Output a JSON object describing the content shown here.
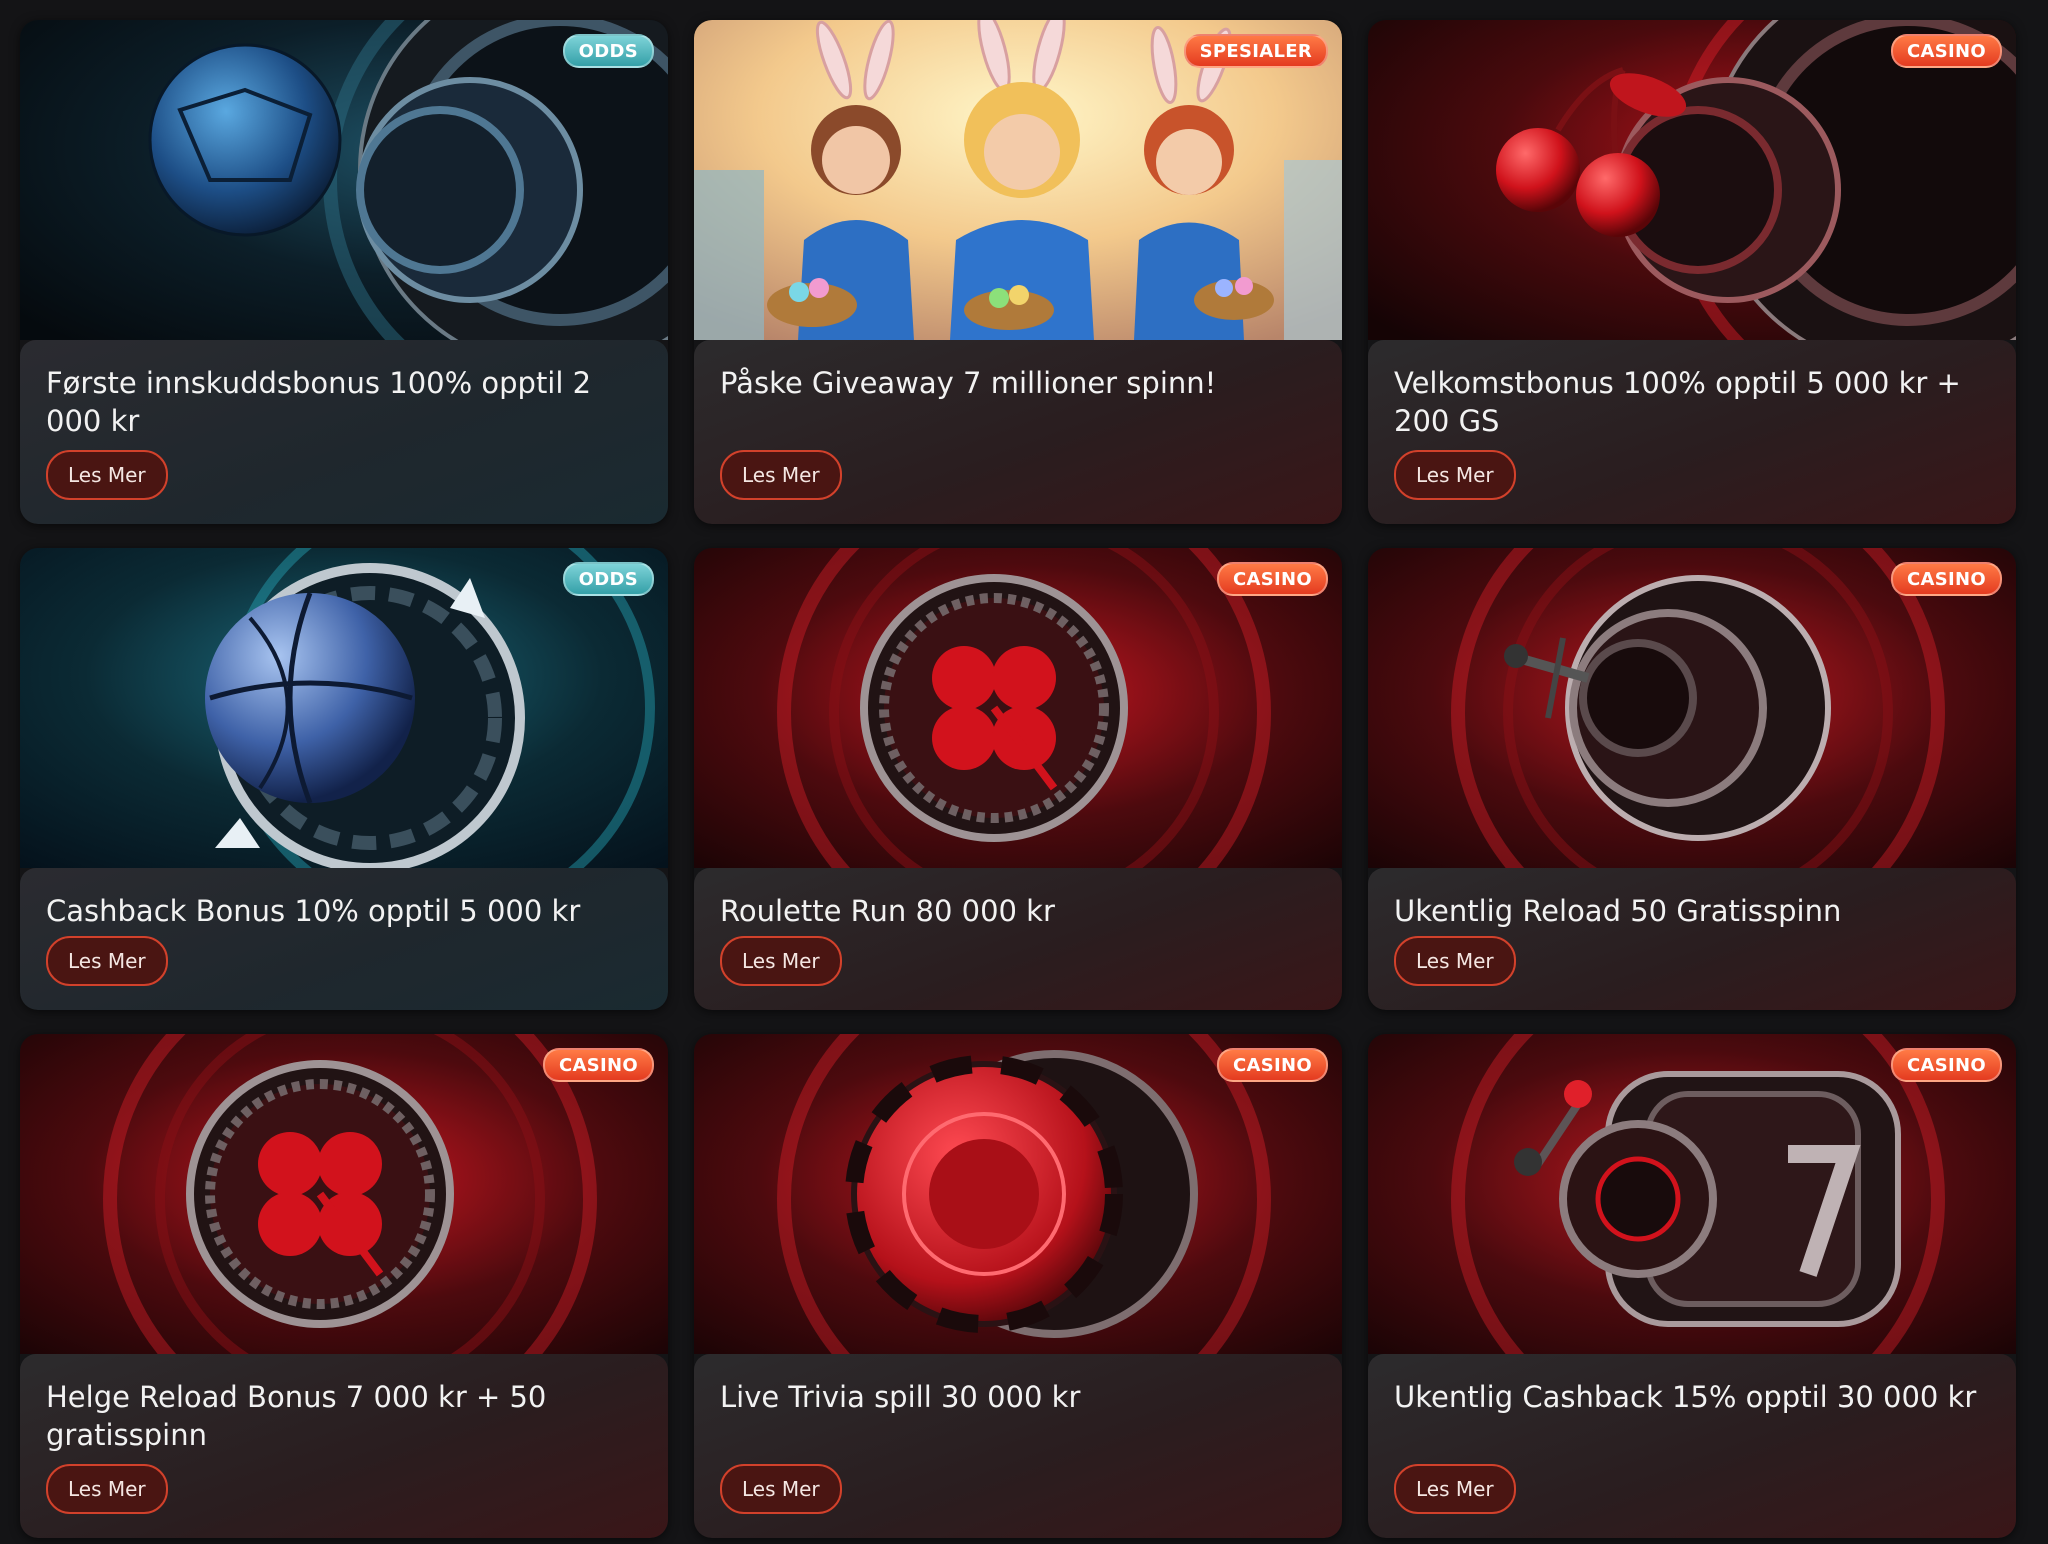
{
  "promotions": [
    {
      "tag": "ODDS",
      "title": "Første innskuddsbonus 100% opptil 2 000 kr",
      "button": "Les Mer",
      "theme": "odds",
      "art_icon": "football-roulette-icon"
    },
    {
      "tag": "SPESIALER",
      "title": "Påske Giveaway 7 millioner spinn!",
      "button": "Les Mer",
      "theme": "special",
      "art_icon": "easter-bunnies-illustration"
    },
    {
      "tag": "CASINO",
      "title": "Velkomstbonus 100% opptil 5 000 kr + 200 GS",
      "button": "Les Mer",
      "theme": "casino",
      "art_icon": "cherry-roulette-icon"
    },
    {
      "tag": "ODDS",
      "title": "Cashback Bonus 10% opptil 5 000 kr",
      "button": "Les Mer",
      "theme": "odds",
      "art_icon": "basketball-cashback-icon"
    },
    {
      "tag": "CASINO",
      "title": "Roulette Run 80 000 kr",
      "button": "Les Mer",
      "theme": "casino",
      "art_icon": "clover-chip-icon"
    },
    {
      "tag": "CASINO",
      "title": "Ukentlig Reload 50 Gratisspinn",
      "button": "Les Mer",
      "theme": "casino",
      "art_icon": "slot-reel-icon"
    },
    {
      "tag": "CASINO",
      "title": "Helge Reload Bonus 7 000 kr + 50 gratisspinn",
      "button": "Les Mer",
      "theme": "casino",
      "art_icon": "clover-chip-icon"
    },
    {
      "tag": "CASINO",
      "title": "Live Trivia spill 30 000 kr",
      "button": "Les Mer",
      "theme": "casino",
      "art_icon": "poker-chip-icon"
    },
    {
      "tag": "CASINO",
      "title": "Ukentlig Cashback 15% opptil 30 000 kr",
      "button": "Les Mer",
      "theme": "casino",
      "art_icon": "slot-seven-icon"
    }
  ],
  "colors": {
    "page_bg": "#141416",
    "accent_red": "#e43b20",
    "accent_teal": "#34a0a8",
    "button_border": "#d2412b"
  }
}
